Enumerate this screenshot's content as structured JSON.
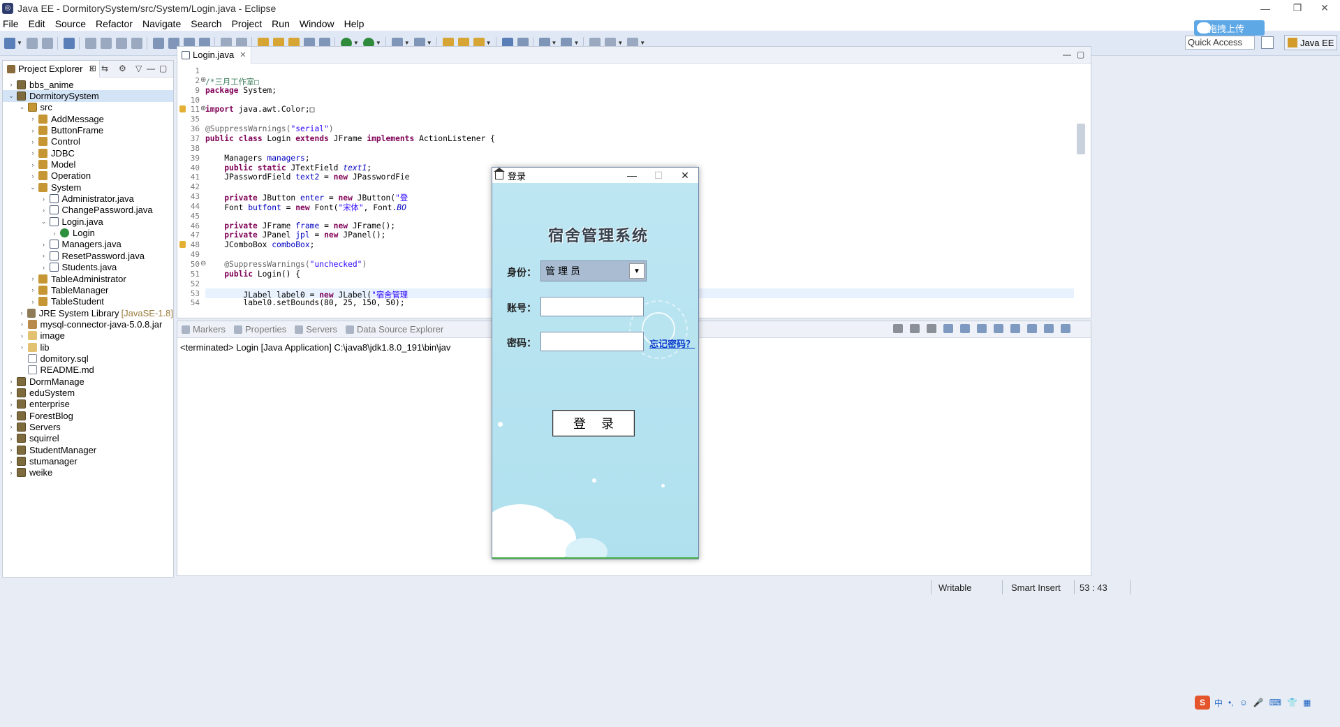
{
  "window": {
    "title": "Java EE - DormitorySystem/src/System/Login.java - Eclipse",
    "controls": [
      "—",
      "❐",
      "✕"
    ]
  },
  "menu": [
    "File",
    "Edit",
    "Source",
    "Refactor",
    "Navigate",
    "Search",
    "Project",
    "Run",
    "Window",
    "Help"
  ],
  "toolbar": {
    "quick_access": "Quick Access",
    "perspective": "Java EE",
    "upload_badge": "拖拽上传"
  },
  "explorer": {
    "tab_label": "Project Explorer",
    "tab_close": "✕",
    "items": [
      {
        "label": "bbs_anime",
        "depth": 0,
        "arrow": "›",
        "icon": "project-icon"
      },
      {
        "label": "DormitorySystem",
        "depth": 0,
        "arrow": "⌄",
        "icon": "project-icon",
        "selected": true
      },
      {
        "label": "src",
        "depth": 1,
        "arrow": "⌄",
        "icon": "source-folder-icon"
      },
      {
        "label": "AddMessage",
        "depth": 2,
        "arrow": "›",
        "icon": "package-icon"
      },
      {
        "label": "ButtonFrame",
        "depth": 2,
        "arrow": "›",
        "icon": "package-icon"
      },
      {
        "label": "Control",
        "depth": 2,
        "arrow": "›",
        "icon": "package-icon"
      },
      {
        "label": "JDBC",
        "depth": 2,
        "arrow": "›",
        "icon": "package-icon"
      },
      {
        "label": "Model",
        "depth": 2,
        "arrow": "›",
        "icon": "package-icon"
      },
      {
        "label": "Operation",
        "depth": 2,
        "arrow": "›",
        "icon": "package-icon"
      },
      {
        "label": "System",
        "depth": 2,
        "arrow": "⌄",
        "icon": "package-icon"
      },
      {
        "label": "Administrator.java",
        "depth": 3,
        "arrow": "›",
        "icon": "java-file-icon"
      },
      {
        "label": "ChangePassword.java",
        "depth": 3,
        "arrow": "›",
        "icon": "java-file-icon"
      },
      {
        "label": "Login.java",
        "depth": 3,
        "arrow": "⌄",
        "icon": "java-file-icon"
      },
      {
        "label": "Login",
        "depth": 4,
        "arrow": "›",
        "icon": "class-icon"
      },
      {
        "label": "Managers.java",
        "depth": 3,
        "arrow": "›",
        "icon": "java-file-icon"
      },
      {
        "label": "ResetPassword.java",
        "depth": 3,
        "arrow": "›",
        "icon": "java-file-icon"
      },
      {
        "label": "Students.java",
        "depth": 3,
        "arrow": "›",
        "icon": "java-file-icon"
      },
      {
        "label": "TableAdministrator",
        "depth": 2,
        "arrow": "›",
        "icon": "package-icon"
      },
      {
        "label": "TableManager",
        "depth": 2,
        "arrow": "›",
        "icon": "package-icon"
      },
      {
        "label": "TableStudent",
        "depth": 2,
        "arrow": "›",
        "icon": "package-icon"
      },
      {
        "label": "JRE System Library",
        "meta": "[JavaSE-1.8]",
        "depth": 1,
        "arrow": "›",
        "icon": "library-icon"
      },
      {
        "label": "mysql-connector-java-5.0.8.jar",
        "depth": 1,
        "arrow": "›",
        "icon": "jar-icon"
      },
      {
        "label": "image",
        "depth": 1,
        "arrow": "›",
        "icon": "folder-icon"
      },
      {
        "label": "lib",
        "depth": 1,
        "arrow": "›",
        "icon": "folder-icon"
      },
      {
        "label": "domitory.sql",
        "depth": 1,
        "arrow": "",
        "icon": "file-icon"
      },
      {
        "label": "README.md",
        "depth": 1,
        "arrow": "",
        "icon": "file-icon"
      },
      {
        "label": "DormManage",
        "depth": 0,
        "arrow": "›",
        "icon": "project-icon"
      },
      {
        "label": "eduSystem",
        "depth": 0,
        "arrow": "›",
        "icon": "project-icon"
      },
      {
        "label": "enterprise",
        "depth": 0,
        "arrow": "›",
        "icon": "project-icon"
      },
      {
        "label": "ForestBlog",
        "depth": 0,
        "arrow": "›",
        "icon": "project-icon"
      },
      {
        "label": "Servers",
        "depth": 0,
        "arrow": "›",
        "icon": "project-icon"
      },
      {
        "label": "squirrel",
        "depth": 0,
        "arrow": "›",
        "icon": "project-icon"
      },
      {
        "label": "StudentManager",
        "depth": 0,
        "arrow": "›",
        "icon": "project-icon"
      },
      {
        "label": "stumanager",
        "depth": 0,
        "arrow": "›",
        "icon": "project-icon"
      },
      {
        "label": "weike",
        "depth": 0,
        "arrow": "›",
        "icon": "project-icon"
      }
    ]
  },
  "editor": {
    "tab_label": "Login.java",
    "tab_close": "✕",
    "lines": [
      {
        "no": "1",
        "html": ""
      },
      {
        "no": "2",
        "fold": "⊕",
        "html": "<span class=\"cmt\">/*三月工作室□</span>"
      },
      {
        "no": "9",
        "html": "<span class=\"kw\">package</span> System;"
      },
      {
        "no": "10",
        "html": ""
      },
      {
        "no": "11",
        "fold": "⊕",
        "marker": true,
        "html": "<span class=\"kw\">import</span> java.awt.Color;□"
      },
      {
        "no": "35",
        "html": ""
      },
      {
        "no": "36",
        "html": "<span class=\"ann\">@SuppressWarnings(</span><span class=\"str\">\"serial\"</span><span class=\"ann\">)</span>"
      },
      {
        "no": "37",
        "html": "<span class=\"kw\">public class</span> Login <span class=\"kw\">extends</span> JFrame <span class=\"kw\">implements</span> ActionListener {"
      },
      {
        "no": "38",
        "html": ""
      },
      {
        "no": "39",
        "html": "    Managers <span class=\"fld\">managers</span>;"
      },
      {
        "no": "40",
        "html": "    <span class=\"kw\">public static</span> JTextField <span class=\"fld\"><i>text1</i></span>;"
      },
      {
        "no": "41",
        "html": "    JPasswordField <span class=\"fld\">text2</span> = <span class=\"kw\">new</span> JPasswordFie"
      },
      {
        "no": "42",
        "html": ""
      },
      {
        "no": "43",
        "html": "    <span class=\"kw\">private</span> JButton <span class=\"fld\">enter</span> = <span class=\"kw\">new</span> JButton(<span class=\"str\">\"登</span>"
      },
      {
        "no": "44",
        "html": "    Font <span class=\"fld\">butfont</span> = <span class=\"kw\">new</span> Font(<span class=\"str\">\"宋体\"</span>, Font.<span class=\"fld\"><i>BO</i></span>"
      },
      {
        "no": "45",
        "html": ""
      },
      {
        "no": "46",
        "html": "    <span class=\"kw\">private</span> JFrame <span class=\"fld\">frame</span> = <span class=\"kw\">new</span> JFrame();"
      },
      {
        "no": "47",
        "html": "    <span class=\"kw\">private</span> JPanel <span class=\"fld\">jpl</span> = <span class=\"kw\">new</span> JPanel();"
      },
      {
        "no": "48",
        "marker": true,
        "html": "    JComboBox <span class=\"fld\">comboBox</span>;"
      },
      {
        "no": "49",
        "html": ""
      },
      {
        "no": "50",
        "fold": "⊖",
        "html": "    <span class=\"ann\">@SuppressWarnings(</span><span class=\"str\">\"unchecked\"</span><span class=\"ann\">)</span>"
      },
      {
        "no": "51",
        "html": "    <span class=\"kw\">public</span> Login() {"
      },
      {
        "no": "52",
        "html": ""
      },
      {
        "no": "53",
        "current": true,
        "html": "        JLabel <span>label0</span> = <span class=\"kw\">new</span> JLabel(<span class=\"str\">\"宿舍管理</span>"
      },
      {
        "no": "54",
        "html": "        label0.setBounds(80, 25, 150, 50);"
      }
    ]
  },
  "console": {
    "tabs": [
      "Markers",
      "Properties",
      "Servers",
      "Data Source Explorer"
    ],
    "line": "<terminated> Login [Java Application] C:\\java8\\jdk1.8.0_191\\bin\\jav"
  },
  "statusbar": {
    "writable": "Writable",
    "insert_mode": "Smart Insert",
    "position": "53 : 43"
  },
  "ime": {
    "logo": "S",
    "mode": "中",
    "glyphs": [
      "•,",
      "☺",
      "🎤",
      "⌨",
      "👕",
      "▦"
    ]
  },
  "login": {
    "title": "登录",
    "controls": [
      "—",
      "☐",
      "✕"
    ],
    "system_title": "宿舍管理系统",
    "identity_label": "身份：",
    "identity_value": "管理员",
    "account_label": "账号：",
    "password_label": "密码：",
    "forgot_password": "忘记密码？",
    "login_button": "登录"
  },
  "colors": {
    "login_bg": "#b9e5f2",
    "toolbar_bg": "#dfe8f4",
    "keyword": "#7f0055",
    "string": "#2a00ff",
    "link": "#0b3dcc"
  }
}
